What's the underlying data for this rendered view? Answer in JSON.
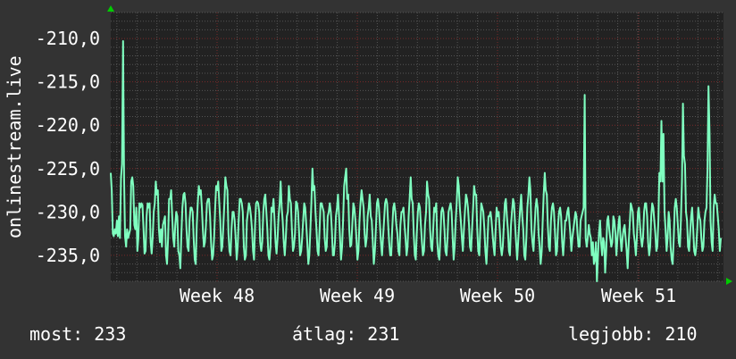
{
  "chart_data": {
    "type": "line",
    "ylabel": "onlinestream.live",
    "yticks": [
      "-210,0",
      "-215,0",
      "-220,0",
      "-225,0",
      "-230,0",
      "-235,0"
    ],
    "ytick_values": [
      -210,
      -215,
      -220,
      -225,
      -230,
      -235
    ],
    "xticks": [
      "Week 48",
      "Week 49",
      "Week 50",
      "Week 51"
    ],
    "ylim": [
      -238,
      -207
    ],
    "grid": true,
    "series": [
      {
        "color": "#7fffc0",
        "values": [
          -225.5,
          -227.5,
          -232.5,
          -232.8,
          -232.0,
          -232.5,
          -231.0,
          -232.8,
          -230.5,
          -233.0,
          -226.0,
          -224.5,
          -210.3,
          -226.0,
          -232.8,
          -234.0,
          -232.0,
          -233.0,
          -232.5,
          -232.0,
          -226.5,
          -226.0,
          -227.0,
          -231.5,
          -232.0,
          -229.5,
          -234.5,
          -233.0,
          -229.0,
          -229.5,
          -229.0,
          -229.2,
          -232.0,
          -234.8,
          -234.5,
          -230.5,
          -229.0,
          -229.5,
          -229.0,
          -233.5,
          -234.8,
          -232.8,
          -230.0,
          -229.0,
          -226.5,
          -228.0,
          -227.5,
          -232.0,
          -233.5,
          -232.0,
          -234.0,
          -231.5,
          -231.0,
          -230.5,
          -235.0,
          -236.0,
          -233.0,
          -228.5,
          -228.5,
          -227.5,
          -230.5,
          -233.0,
          -234.0,
          -231.5,
          -230.0,
          -230.5,
          -234.5,
          -235.0,
          -236.5,
          -232.5,
          -229.5,
          -228.0,
          -227.8,
          -229.0,
          -232.0,
          -234.0,
          -234.5,
          -231.0,
          -229.5,
          -229.5,
          -230.0,
          -233.0,
          -235.5,
          -236.0,
          -231.5,
          -229.0,
          -227.0,
          -228.0,
          -227.5,
          -229.5,
          -232.0,
          -234.0,
          -233.5,
          -231.5,
          -229.0,
          -228.5,
          -228.5,
          -230.5,
          -233.5,
          -235.5,
          -235.0,
          -233.0,
          -229.5,
          -227.0,
          -227.5,
          -226.5,
          -229.0,
          -231.0,
          -234.5,
          -234.0,
          -231.5,
          -229.0,
          -226.0,
          -227.0,
          -227.5,
          -232.5,
          -234.5,
          -235.0,
          -232.0,
          -230.0,
          -230.0,
          -231.0,
          -233.0,
          -235.5,
          -234.0,
          -231.0,
          -228.5,
          -228.5,
          -229.0,
          -230.0,
          -234.0,
          -235.5,
          -235.0,
          -231.0,
          -230.0,
          -229.0,
          -229.5,
          -230.5,
          -232.0,
          -234.5,
          -235.5,
          -231.5,
          -229.0,
          -228.8,
          -229.0,
          -230.0,
          -233.5,
          -234.5,
          -233.5,
          -230.0,
          -228.5,
          -228.0,
          -230.0,
          -232.0,
          -235.0,
          -235.5,
          -234.0,
          -229.5,
          -230.0,
          -228.5,
          -231.0,
          -233.5,
          -234.8,
          -233.0,
          -230.5,
          -229.0,
          -226.5,
          -229.5,
          -231.0,
          -233.5,
          -235.0,
          -233.0,
          -230.5,
          -230.0,
          -227.0,
          -228.5,
          -229.0,
          -232.0,
          -234.5,
          -234.0,
          -232.5,
          -228.8,
          -229.0,
          -230.0,
          -232.5,
          -235.0,
          -234.5,
          -233.0,
          -231.0,
          -229.0,
          -229.5,
          -231.5,
          -233.5,
          -236.0,
          -235.0,
          -232.0,
          -229.0,
          -225.0,
          -227.5,
          -227.0,
          -230.0,
          -232.0,
          -234.5,
          -235.0,
          -232.0,
          -229.0,
          -229.0,
          -229.5,
          -230.0,
          -233.0,
          -234.5,
          -234.0,
          -230.5,
          -230.0,
          -229.0,
          -230.0,
          -232.0,
          -235.0,
          -235.0,
          -233.5,
          -230.5,
          -229.5,
          -228.0,
          -230.5,
          -233.0,
          -235.5,
          -234.0,
          -231.0,
          -227.0,
          -226.0,
          -225.0,
          -228.5,
          -228.0,
          -232.0,
          -234.0,
          -233.8,
          -231.5,
          -229.0,
          -229.5,
          -231.0,
          -233.0,
          -235.5,
          -234.5,
          -231.0,
          -229.0,
          -227.5,
          -228.5,
          -229.5,
          -232.5,
          -234.0,
          -233.0,
          -230.5,
          -229.5,
          -228.0,
          -230.5,
          -231.0,
          -233.5,
          -236.0,
          -234.5,
          -232.0,
          -229.0,
          -228.5,
          -229.5,
          -231.5,
          -233.5,
          -235.0,
          -233.0,
          -231.0,
          -229.0,
          -228.5,
          -229.0,
          -231.5,
          -233.5,
          -235.0,
          -235.0,
          -232.0,
          -229.5,
          -229.0,
          -230.0,
          -231.5,
          -232.5,
          -234.5,
          -235.0,
          -231.5,
          -230.0,
          -230.0,
          -229.5,
          -231.5,
          -233.0,
          -235.0,
          -234.0,
          -230.5,
          -228.5,
          -226.0,
          -228.5,
          -229.0,
          -232.5,
          -235.0,
          -235.5,
          -232.5,
          -230.0,
          -229.0,
          -229.5,
          -231.5,
          -233.5,
          -235.0,
          -234.5,
          -231.5,
          -230.0,
          -226.5,
          -228.0,
          -228.5,
          -232.0,
          -234.0,
          -234.5,
          -232.0,
          -229.5,
          -230.0,
          -229.0,
          -233.5,
          -235.0,
          -235.5,
          -233.0,
          -230.0,
          -229.5,
          -230.0,
          -232.0,
          -234.5,
          -235.0,
          -233.0,
          -230.0,
          -229.5,
          -229.0,
          -230.0,
          -233.0,
          -235.5,
          -234.0,
          -231.0,
          -229.0,
          -226.0,
          -227.0,
          -229.5,
          -231.0,
          -233.0,
          -234.5,
          -232.0,
          -230.0,
          -228.0,
          -228.5,
          -229.5,
          -231.5,
          -234.0,
          -234.5,
          -232.0,
          -229.5,
          -227.0,
          -228.0,
          -228.0,
          -232.0,
          -234.5,
          -235.0,
          -232.0,
          -229.0,
          -229.5,
          -230.0,
          -232.0,
          -234.5,
          -236.0,
          -233.5,
          -230.5,
          -230.5,
          -230.0,
          -231.0,
          -232.5,
          -234.0,
          -235.0,
          -232.0,
          -229.5,
          -230.5,
          -230.0,
          -232.0,
          -234.0,
          -235.0,
          -234.0,
          -231.5,
          -229.0,
          -228.5,
          -230.5,
          -232.0,
          -234.5,
          -235.0,
          -231.5,
          -230.0,
          -228.5,
          -229.0,
          -231.5,
          -233.5,
          -235.5,
          -233.5,
          -231.5,
          -229.5,
          -228.0,
          -230.5,
          -232.0,
          -235.0,
          -235.5,
          -233.0,
          -229.5,
          -228.0,
          -226.0,
          -227.5,
          -232.0,
          -233.5,
          -234.5,
          -232.0,
          -229.5,
          -228.5,
          -229.5,
          -232.5,
          -234.0,
          -236.0,
          -234.5,
          -231.0,
          -228.0,
          -225.5,
          -227.5,
          -228.0,
          -231.5,
          -234.0,
          -234.5,
          -231.0,
          -229.5,
          -229.0,
          -230.0,
          -232.5,
          -235.0,
          -234.5,
          -231.5,
          -230.0,
          -229.5,
          -230.5,
          -233.5,
          -235.0,
          -233.0,
          -231.0,
          -231.0,
          -230.0,
          -229.5,
          -231.0,
          -232.5,
          -234.5,
          -233.0,
          -232.0,
          -231.0,
          -230.0,
          -230.5,
          -232.5,
          -234.0,
          -234.0,
          -231.0,
          -230.5,
          -230.0,
          -229.5,
          -216.5,
          -233.0,
          -234.0,
          -233.0,
          -231.5,
          -232.5,
          -233.0,
          -235.0,
          -233.5,
          -236.0,
          -235.5,
          -233.5,
          -238.0,
          -235.0,
          -232.5,
          -231.0,
          -233.5,
          -235.0,
          -233.0,
          -233.5,
          -237.0,
          -234.5,
          -231.0,
          -230.5,
          -232.0,
          -233.0,
          -234.0,
          -233.5,
          -230.5,
          -231.0,
          -232.5,
          -235.0,
          -233.0,
          -231.5,
          -230.5,
          -233.0,
          -234.5,
          -233.0,
          -232.0,
          -231.5,
          -233.0,
          -234.5,
          -236.5,
          -233.5,
          -231.5,
          -229.0,
          -229.5,
          -230.0,
          -232.5,
          -233.5,
          -235.0,
          -233.0,
          -230.0,
          -229.5,
          -231.5,
          -233.0,
          -234.0,
          -233.0,
          -230.0,
          -229.0,
          -229.0,
          -230.5,
          -233.5,
          -235.0,
          -234.0,
          -230.5,
          -229.0,
          -229.5,
          -231.0,
          -232.5,
          -234.5,
          -234.0,
          -231.0,
          -225.5,
          -226.5,
          -219.5,
          -226.5,
          -221.0,
          -230.0,
          -232.0,
          -234.5,
          -233.0,
          -230.0,
          -231.0,
          -234.0,
          -235.5,
          -236.0,
          -233.0,
          -229.5,
          -228.5,
          -229.5,
          -231.5,
          -233.5,
          -234.0,
          -231.0,
          -226.5,
          -217.5,
          -223.5,
          -224.5,
          -230.0,
          -231.0,
          -234.0,
          -234.5,
          -232.5,
          -230.5,
          -229.5,
          -232.0,
          -234.5,
          -235.0,
          -234.0,
          -232.0,
          -229.5,
          -230.5,
          -231.0,
          -233.0,
          -234.5,
          -234.0,
          -231.0,
          -230.0,
          -229.5,
          -225.0,
          -215.5,
          -221.0,
          -231.0,
          -233.5,
          -234.5,
          -229.5,
          -228.0,
          -229.0,
          -229.0,
          -230.5,
          -232.0,
          -234.5,
          -233.0
        ]
      }
    ]
  },
  "stats": {
    "now": "most: 233",
    "avg": "átlag: 231",
    "best": "legjobb: 210"
  },
  "colors": {
    "background": "#333333",
    "plot": "#222222",
    "major_grid": "#7a2a2a",
    "minor_grid": "#555555",
    "line": "#7fffc0",
    "arrow": "#00cc00"
  }
}
